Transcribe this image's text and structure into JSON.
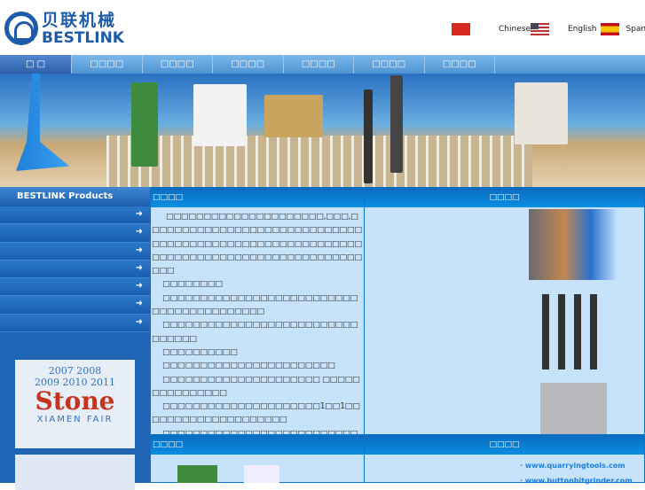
{
  "logo": {
    "cn": "贝联机械",
    "en": "BESTLINK"
  },
  "languages": [
    {
      "label": "Chinese",
      "flag": "china-flag"
    },
    {
      "label": "English",
      "flag": "us-flag"
    },
    {
      "label": "Spanish",
      "flag": "spain-flag"
    }
  ],
  "nav": [
    "□ □",
    "□□□□",
    "□□□□",
    "□□□□",
    "□□□□",
    "□□□□",
    "□□□□"
  ],
  "sidebar": {
    "title": "BESTLINK Products",
    "arrow": "➜"
  },
  "fair": {
    "years1": "2007  2008",
    "years2": "2009  2010  2011",
    "name": "Stone",
    "city": "XIAMEN FAIR"
  },
  "intro": {
    "title": "□□□□",
    "paragraphs": [
      "□□□□□□□□□□□□□□□□□□□□□,□□□,□□□□□□□□□□□□□□□□□□□□□□□□□□□□□□□□□□□□□□□□□□□□□□□□□□□□□□□□□□□□□□□□□□□□□□□□□□□□□□□□□□□□□□□□",
      "□□□□□□□□",
      "□□□□□□□□□□□□□□□□□□□□□□□□□□□□□□□□□□□□□□□□□",
      "□□□□□□□□□□□□□□□□□□□□□□□□□□□□□□□□",
      "□□□□□□□□□□",
      "□□□□□□□□□□□□□□□□□□□□□□□",
      "□□□□□□□□□□□□□□□□□□□□□ □□□□□□□□□□□□□□□",
      "□□□□□□□□□□□□□□□□□□□□□1□□1□□□□□□□□□□□□□□□□□□□□",
      "□□□□□□□□□□□□□□□□□□□□□□□□□□□□□□□□□□□□□□□□□"
    ]
  },
  "products": {
    "title": "□□□□"
  },
  "news": {
    "title": "□□□□"
  },
  "links": {
    "title": "□□□□",
    "items": [
      "· www.quarryingtools.com",
      "· www.buttonbitgrinder.com"
    ]
  }
}
